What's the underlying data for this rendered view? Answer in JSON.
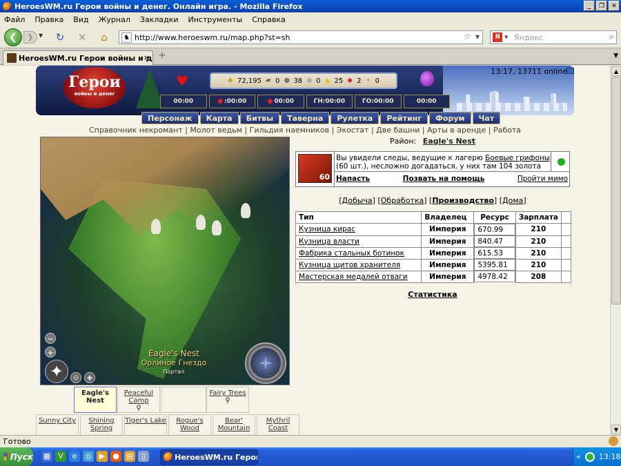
{
  "window": {
    "title": "HeroesWM.ru Герои войны и денег. Онлайн игра. - Mozilla Firefox",
    "minimize": "_",
    "maximize": "❐",
    "close": "✕"
  },
  "menu": [
    "Файл",
    "Правка",
    "Вид",
    "Журнал",
    "Закладки",
    "Инструменты",
    "Справка"
  ],
  "nav": {
    "url": "http://www.heroeswm.ru/map.php?st=sh",
    "search_placeholder": "Яндекс",
    "search_engine": "Я"
  },
  "tab": {
    "label": "HeroesWM.ru Герои войны и денег. ...",
    "new_tab": "+"
  },
  "header": {
    "time_online": "13:17, 13711 online",
    "logo": "Герои",
    "logo_sub": "войны и денег",
    "resources": [
      {
        "icon": "gold-icon",
        "glyph": "◆",
        "color": "#d4a21a",
        "value": "72,195"
      },
      {
        "icon": "wood-icon",
        "glyph": "▰",
        "color": "#8a5a2b",
        "value": "0"
      },
      {
        "icon": "ore-icon",
        "glyph": "●",
        "color": "#7a7a7a",
        "value": "38"
      },
      {
        "icon": "mercury-icon",
        "glyph": "◉",
        "color": "#a0a0b0",
        "value": "0"
      },
      {
        "icon": "sulfur-icon",
        "glyph": "▲",
        "color": "#e0c020",
        "value": "25"
      },
      {
        "icon": "crystal-icon",
        "glyph": "◆",
        "color": "#d03030",
        "value": "2"
      },
      {
        "icon": "gems-icon",
        "glyph": "✦",
        "color": "#e0a040",
        "value": "0"
      }
    ],
    "timers": [
      {
        "prefix": "",
        "value": "00:00",
        "dot": false
      },
      {
        "prefix": "",
        "value": ":00:00",
        "dot": true
      },
      {
        "prefix": "",
        "value": "00:00",
        "dot": true
      },
      {
        "prefix": "ГН: ",
        "value": "00:00",
        "dot": false
      },
      {
        "prefix": "ГО: ",
        "value": "00:00",
        "dot": false
      },
      {
        "prefix": "",
        "value": "00:00",
        "dot": false
      }
    ]
  },
  "game_nav": [
    "Персонаж",
    "Карта",
    "Битвы",
    "Таверна",
    "Рулетка",
    "Рейтинг",
    "Форум",
    "Чат"
  ],
  "links": [
    "Справочник некромант",
    "Молот ведьм",
    "Гильдия наемников",
    "Экостат",
    "Две башни",
    "Арты в аренде",
    "Работа"
  ],
  "map": {
    "location": "Eagle's Nest",
    "location_ru": "Орлиное Гнездо",
    "portal": "Портал",
    "zoom_minus": "−",
    "zoom_plus": "+"
  },
  "district": {
    "label": "Район:",
    "value": "Eagle's Nest"
  },
  "event": {
    "level": "60",
    "text_before": "Вы увидели следы, ведущие к лагерю ",
    "link": "Боевые грифоны",
    "text_after": " (60 шт.), несложно догадаться, у них там 104 золота",
    "attack": "Напасть",
    "call_help": "Позвать на помощь",
    "pass_by": "Пройти мимо"
  },
  "categories": [
    {
      "label": "Добыча",
      "active": false
    },
    {
      "label": "Обработка",
      "active": false
    },
    {
      "label": "Производство",
      "active": true
    },
    {
      "label": "Дома",
      "active": false
    }
  ],
  "table": {
    "headers": [
      "Тип",
      "Владелец",
      "Ресурс",
      "Зарплата"
    ],
    "rows": [
      {
        "type": "Кузница кирас",
        "owner": "Империя",
        "resource": "670.99",
        "salary": "210"
      },
      {
        "type": "Кузница власти",
        "owner": "Империя",
        "resource": "840.47",
        "salary": "210"
      },
      {
        "type": "Фабрика стальных ботинок",
        "owner": "Империя",
        "resource": "615.53",
        "salary": "210"
      },
      {
        "type": "Кузница щитов хранителя",
        "owner": "Империя",
        "resource": "5395.81",
        "salary": "210"
      },
      {
        "type": "Мастерская медалей отваги",
        "owner": "Империя",
        "resource": "4978.42",
        "salary": "208"
      }
    ]
  },
  "stats_link": "Статистика",
  "sectors": {
    "row1": [
      {
        "name": "Eagle's Nest",
        "current": true,
        "search": false
      },
      {
        "name": "Peaceful Camp",
        "current": false,
        "search": true
      },
      {
        "name": "",
        "current": false,
        "search": false
      },
      {
        "name": "Fairy Trees",
        "current": false,
        "search": true
      }
    ],
    "row2": [
      "Sunny City",
      "Shining Spring",
      "Tiger's Lake",
      "Rogue's Wood",
      "Bear' Mountain",
      "Mythril Coast"
    ]
  },
  "status": "Готово",
  "taskbar": {
    "start": "Пуск",
    "task": "HeroesWM.ru Герои в...",
    "clock": "13:18",
    "tray_arrow": "«"
  }
}
